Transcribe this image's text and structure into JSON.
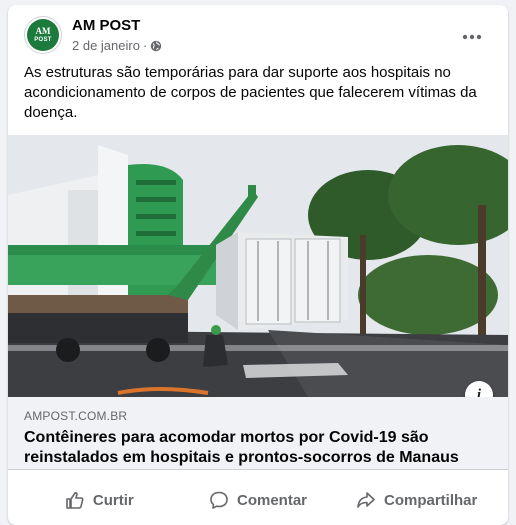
{
  "post": {
    "page_name": "AM POST",
    "avatar_text": {
      "top": "AM",
      "bottom": "POST"
    },
    "date": "2 de janeiro",
    "separator": "·",
    "privacy_icon": "globe-icon",
    "more_icon": "more-options-icon",
    "text": "As estruturas são temporárias para dar suporte aos hospitais no acondicionamento de corpos de pacientes que falecerem vítimas da doença."
  },
  "link": {
    "domain": "AMPOST.COM.BR",
    "title": "Contêineres para acomodar mortos por Covid-19 são reinstalados em hospitais e prontos-socorros de Manaus",
    "info_icon": "i"
  },
  "actions": {
    "like": "Curtir",
    "comment": "Comentar",
    "share": "Compartilhar"
  },
  "colors": {
    "brand_green": "#1b7a3c",
    "secondary_text": "#65676b",
    "card_bg": "#ffffff",
    "page_bg": "#f0f2f5"
  }
}
